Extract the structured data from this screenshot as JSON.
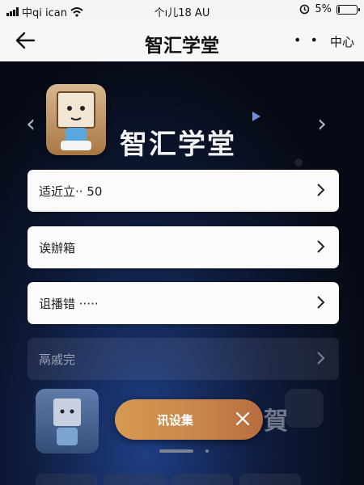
{
  "status_bar": {
    "carrier": "中qi ican",
    "time": "个ı儿18 AU",
    "battery_percent": "5%",
    "battery_level": 0.05
  },
  "nav": {
    "title": "智汇学堂",
    "more": "• •",
    "action": "中心"
  },
  "hero": {
    "app_name": "智汇学堂"
  },
  "menu": {
    "items": [
      {
        "label": "适近立·· 50"
      },
      {
        "label": "诶辦箱"
      },
      {
        "label": "诅播错 ·····"
      },
      {
        "label": "鬲戚完"
      }
    ]
  },
  "promo": {
    "label": "讯设集",
    "ghost_text": "賀"
  },
  "colors": {
    "pill_start": "#d69a52",
    "pill_end": "#b86c40",
    "background": "#0b0f1c"
  }
}
